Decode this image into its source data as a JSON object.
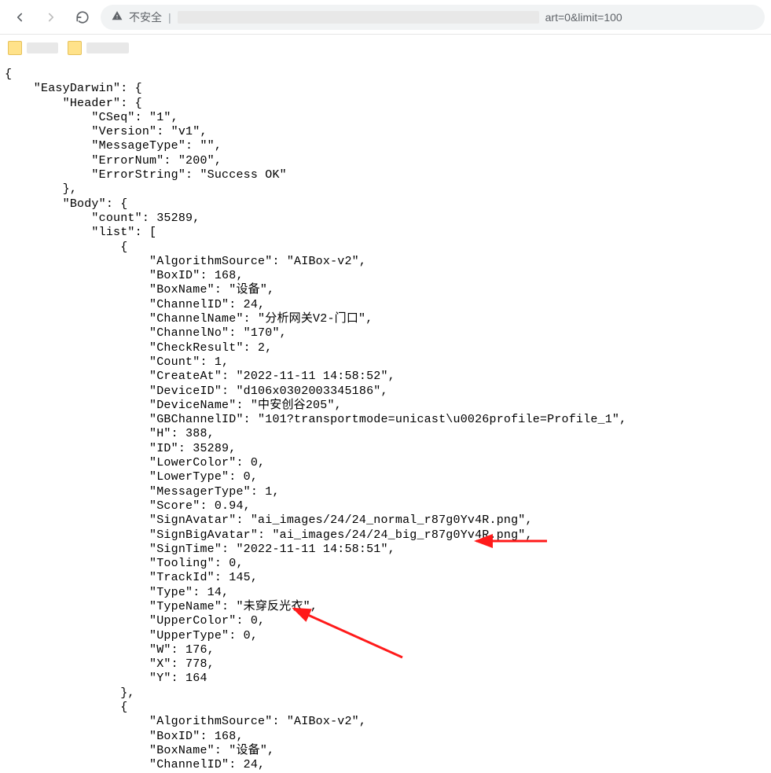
{
  "browser": {
    "insecure_label": "不安全",
    "url_visible_suffix": "art=0&limit=100"
  },
  "json_text": "{\n    \"EasyDarwin\": {\n        \"Header\": {\n            \"CSeq\": \"1\",\n            \"Version\": \"v1\",\n            \"MessageType\": \"\",\n            \"ErrorNum\": \"200\",\n            \"ErrorString\": \"Success OK\"\n        },\n        \"Body\": {\n            \"count\": 35289,\n            \"list\": [\n                {\n                    \"AlgorithmSource\": \"AIBox-v2\",\n                    \"BoxID\": 168,\n                    \"BoxName\": \"设备\",\n                    \"ChannelID\": 24,\n                    \"ChannelName\": \"分析网关V2-门口\",\n                    \"ChannelNo\": \"170\",\n                    \"CheckResult\": 2,\n                    \"Count\": 1,\n                    \"CreateAt\": \"2022-11-11 14:58:52\",\n                    \"DeviceID\": \"d106x0302003345186\",\n                    \"DeviceName\": \"中安创谷205\",\n                    \"GBChannelID\": \"101?transportmode=unicast\\u0026profile=Profile_1\",\n                    \"H\": 388,\n                    \"ID\": 35289,\n                    \"LowerColor\": 0,\n                    \"LowerType\": 0,\n                    \"MessagerType\": 1,\n                    \"Score\": 0.94,\n                    \"SignAvatar\": \"ai_images/24/24_normal_r87g0Yv4R.png\",\n                    \"SignBigAvatar\": \"ai_images/24/24_big_r87g0Yv4R.png\",\n                    \"SignTime\": \"2022-11-11 14:58:51\",\n                    \"Tooling\": 0,\n                    \"TrackId\": 145,\n                    \"Type\": 14,\n                    \"TypeName\": \"未穿反光衣\",\n                    \"UpperColor\": 0,\n                    \"UpperType\": 0,\n                    \"W\": 176,\n                    \"X\": 778,\n                    \"Y\": 164\n                },\n                {\n                    \"AlgorithmSource\": \"AIBox-v2\",\n                    \"BoxID\": 168,\n                    \"BoxName\": \"设备\",\n                    \"ChannelID\": 24,"
}
